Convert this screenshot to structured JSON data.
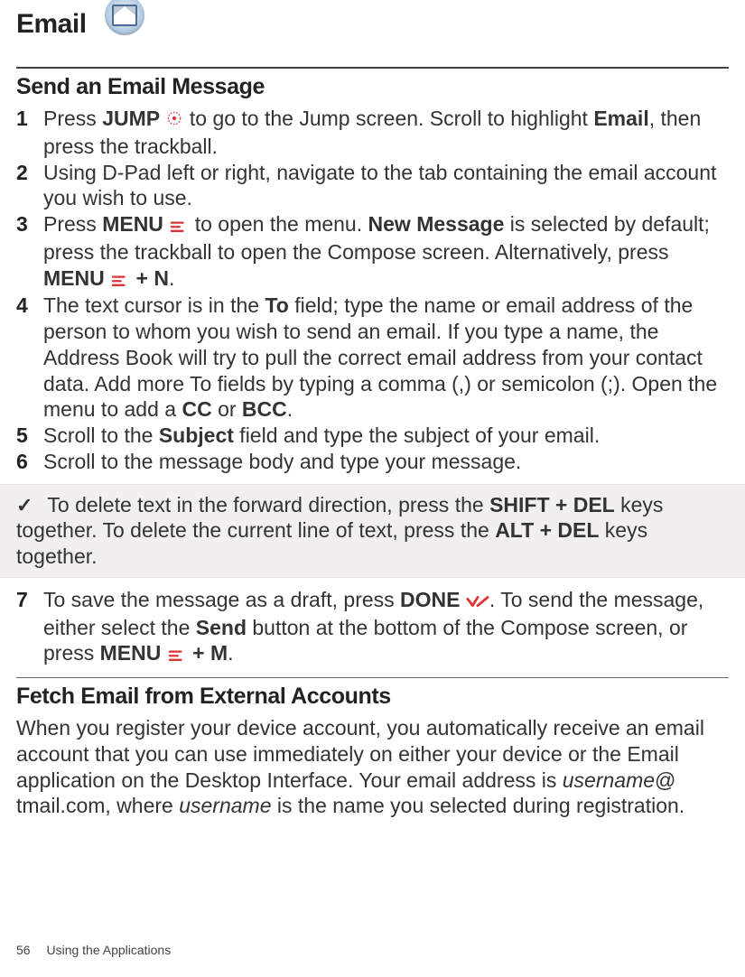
{
  "header": {
    "app_title": "Email"
  },
  "section1": {
    "title": "Send an Email Message",
    "steps": {
      "s1a": "Press ",
      "s1_jump": "JUMP",
      "s1b": " to go to the Jump screen. Scroll to highlight ",
      "s1_email": "Email",
      "s1c": ", then press the trackball.",
      "s2": "Using D-Pad left or right, navigate to the tab containing the email account you wish to use.",
      "s3a": "Press ",
      "s3_menu": "MENU",
      "s3b": "  to open the menu. ",
      "s3_newmsg": "New Message",
      "s3c": " is selected by default; press the trackball to open the Compose screen. Alternatively, press ",
      "s3_menu2": "MENU",
      "s3d": " + N",
      "s3e": ".",
      "s4a": "The text cursor is in the ",
      "s4_to": "To",
      "s4b": " field; type the name or email address of the person to whom you wish to send an email. If you type a name, the Address Book will try to pull the correct email address from your contact data. Add more To fields by typing a comma (,) or semicolon (;). Open the menu to add a ",
      "s4_cc": "CC",
      "s4c": " or ",
      "s4_bcc": "BCC",
      "s4d": ".",
      "s5a": "Scroll to the ",
      "s5_subject": "Subject",
      "s5b": " field and type the subject of your email.",
      "s6": "Scroll to the message body and type your message.",
      "s7a": "To save the message as a draft, press ",
      "s7_done": "DONE",
      "s7b": ". To send the message, either select the ",
      "s7_send": "Send",
      "s7c": " button at the bottom of the Compose screen, or press ",
      "s7_menu": "MENU",
      "s7d": " + M",
      "s7e": "."
    },
    "tip": {
      "a": "  To delete text in the forward direction, press the ",
      "k1": "SHIFT + DEL",
      "b": " keys together. To delete the current line of text, press the ",
      "k2": "ALT + DEL",
      "c": " keys together."
    }
  },
  "section2": {
    "title": "Fetch Email from External Accounts",
    "para_a": "When you register your device account, you automatically receive an email account that you can use immediately on either your device or the Email application on the Desktop Interface. Your email address is ",
    "username1": "username",
    "at": "@",
    "domain_line": "tmail.com, where ",
    "username2": "username",
    "para_b": " is the name you selected during registration."
  },
  "footer": {
    "page_number": "56",
    "section_label": "Using the Applications"
  }
}
